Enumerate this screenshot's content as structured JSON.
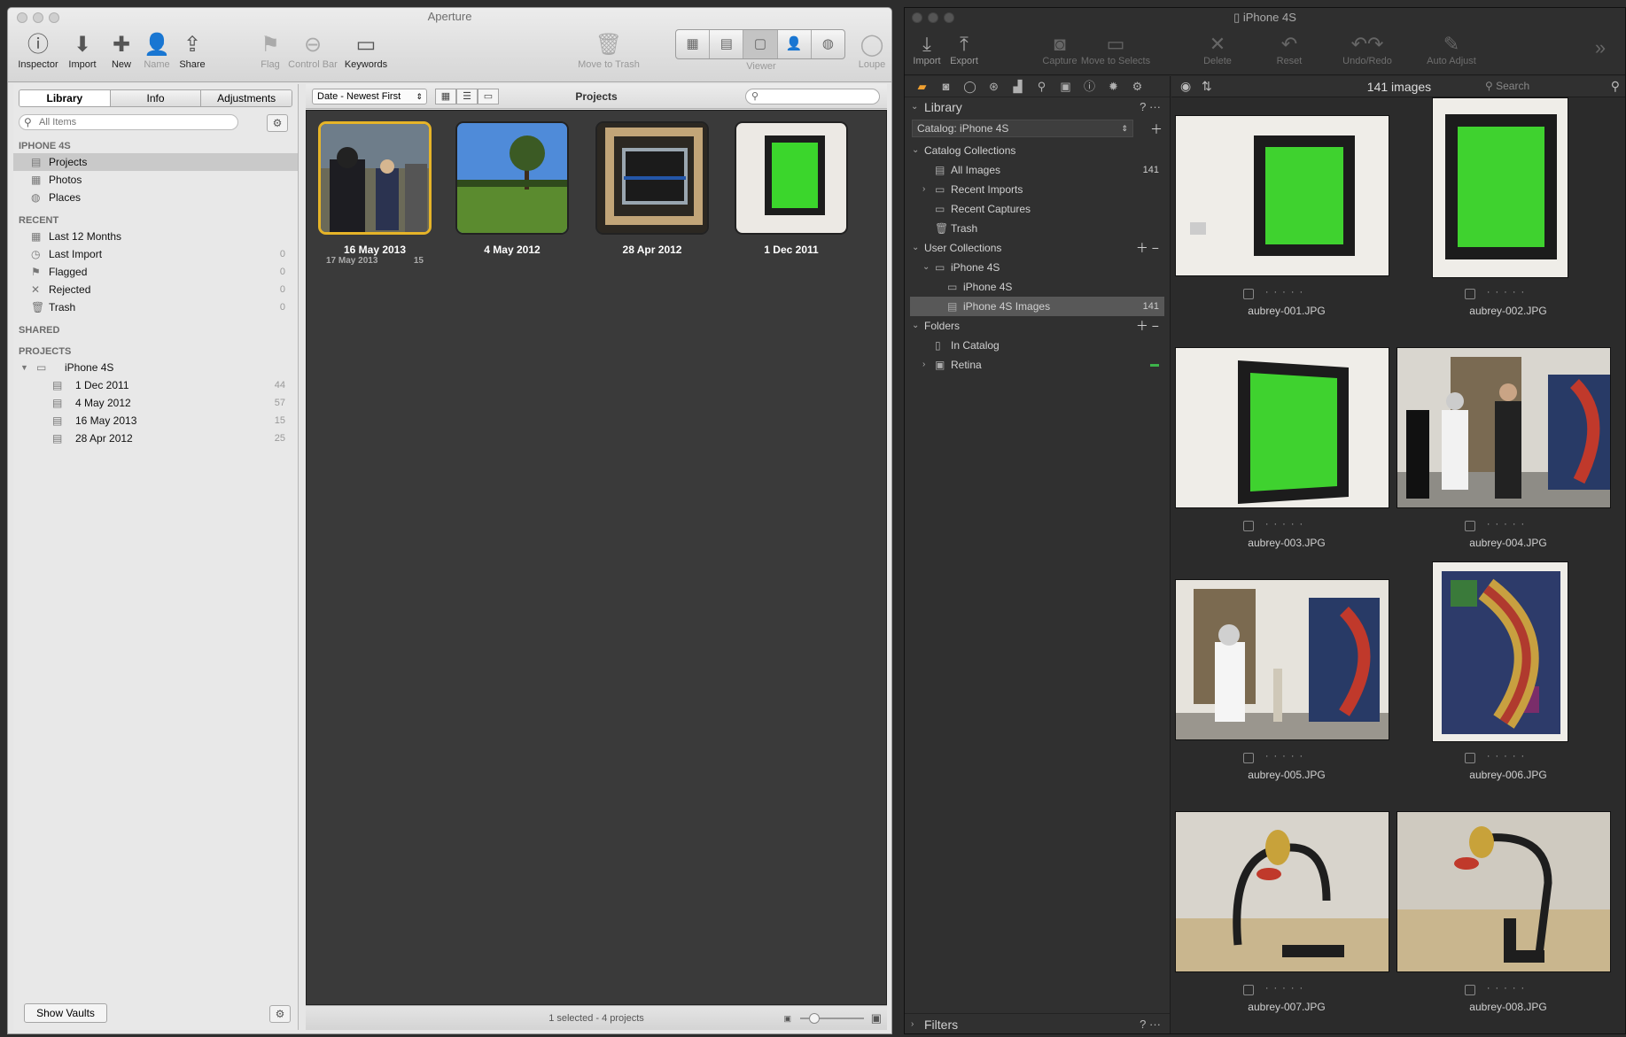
{
  "aperture": {
    "title": "Aperture",
    "toolbar": {
      "inspector": "Inspector",
      "import": "Import",
      "new": "New",
      "name": "Name",
      "share": "Share",
      "flag": "Flag",
      "control_bar": "Control Bar",
      "keywords": "Keywords",
      "move_to_trash": "Move to Trash",
      "viewer": "Viewer",
      "loupe": "Loupe"
    },
    "tabs": {
      "library": "Library",
      "info": "Info",
      "adjustments": "Adjustments"
    },
    "search_placeholder": "All Items",
    "sections": {
      "device": "IPHONE 4S",
      "recent": "RECENT",
      "shared": "SHARED",
      "projects": "PROJECTS"
    },
    "device_items": [
      {
        "label": "Projects",
        "icon": "projects-icon"
      },
      {
        "label": "Photos",
        "icon": "photos-icon"
      },
      {
        "label": "Places",
        "icon": "globe-icon"
      }
    ],
    "recent_items": [
      {
        "label": "Last 12 Months",
        "count": ""
      },
      {
        "label": "Last Import",
        "count": "0"
      },
      {
        "label": "Flagged",
        "count": "0"
      },
      {
        "label": "Rejected",
        "count": "0"
      },
      {
        "label": "Trash",
        "count": "0"
      }
    ],
    "project_folder": "iPhone 4S",
    "project_items": [
      {
        "label": "1 Dec 2011",
        "count": "44"
      },
      {
        "label": "4 May 2012",
        "count": "57"
      },
      {
        "label": "16 May 2013",
        "count": "15"
      },
      {
        "label": "28 Apr 2012",
        "count": "25"
      }
    ],
    "show_vaults": "Show Vaults",
    "browser": {
      "sort": "Date - Newest First",
      "title": "Projects",
      "status": "1 selected - 4 projects"
    },
    "projects": [
      {
        "name": "16 May 2013",
        "date": "17 May 2013",
        "count": "15"
      },
      {
        "name": "4 May 2012",
        "date": "",
        "count": ""
      },
      {
        "name": "28 Apr 2012",
        "date": "",
        "count": ""
      },
      {
        "name": "1 Dec 2011",
        "date": "",
        "count": ""
      }
    ]
  },
  "captureone": {
    "title": "iPhone 4S",
    "toolbar": {
      "import": "Import",
      "export": "Export",
      "capture": "Capture",
      "move_to_selects": "Move to Selects",
      "delete": "Delete",
      "reset": "Reset",
      "undo_redo": "Undo/Redo",
      "auto_adjust": "Auto Adjust"
    },
    "library": "Library",
    "catalog": "Catalog: iPhone 4S",
    "catalog_collections": "Catalog Collections",
    "all_images": "All Images",
    "all_images_count": "141",
    "recent_imports": "Recent Imports",
    "recent_captures": "Recent Captures",
    "trash": "Trash",
    "user_collections": "User Collections",
    "uc_group": "iPhone 4S",
    "uc_album": "iPhone 4S",
    "uc_smart": "iPhone 4S Images",
    "uc_smart_count": "141",
    "folders": "Folders",
    "in_catalog": "In Catalog",
    "retina": "Retina",
    "filters": "Filters",
    "image_count": "141 images",
    "search_placeholder": "Search",
    "images": [
      "aubrey-001.JPG",
      "aubrey-002.JPG",
      "aubrey-003.JPG",
      "aubrey-004.JPG",
      "aubrey-005.JPG",
      "aubrey-006.JPG",
      "aubrey-007.JPG",
      "aubrey-008.JPG"
    ]
  }
}
